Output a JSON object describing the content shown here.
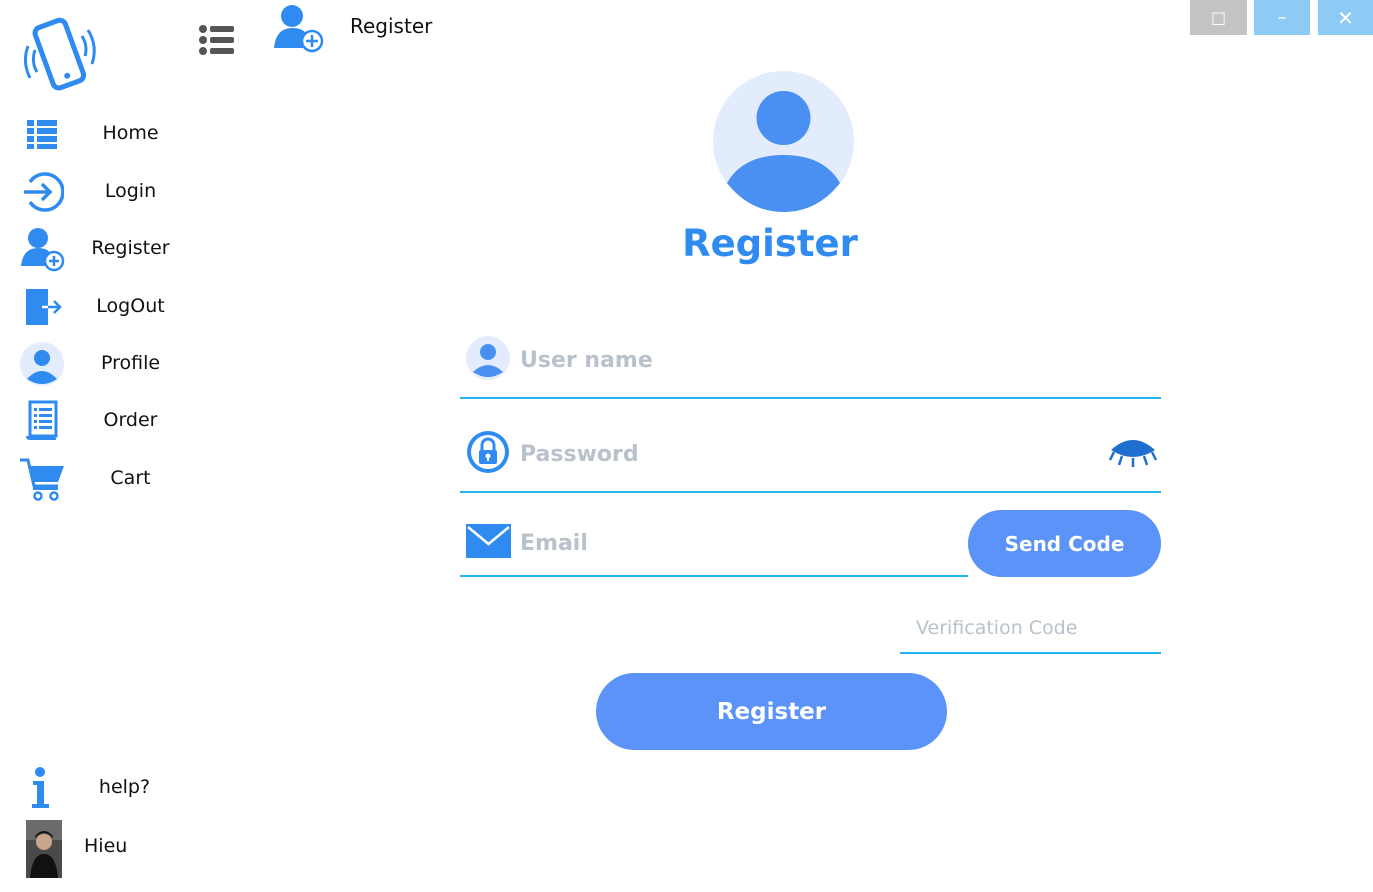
{
  "window": {
    "maximize_glyph": "□",
    "minimize_glyph": "–",
    "close_glyph": "✕"
  },
  "topbar": {
    "title": "Register"
  },
  "sidebar": {
    "items": [
      {
        "label": "Home",
        "icon": "list-icon"
      },
      {
        "label": "Login",
        "icon": "login-arrow-icon"
      },
      {
        "label": "Register",
        "icon": "add-user-icon"
      },
      {
        "label": "LogOut",
        "icon": "logout-icon"
      },
      {
        "label": "Profile",
        "icon": "profile-icon"
      },
      {
        "label": "Order",
        "icon": "order-document-icon"
      },
      {
        "label": "Cart",
        "icon": "cart-icon"
      }
    ],
    "help_label": "help?",
    "user_name": "Hieu"
  },
  "form": {
    "title": "Register",
    "username_placeholder": "User name",
    "password_placeholder": "Password",
    "email_placeholder": "Email",
    "send_code_label": "Send Code",
    "verification_placeholder": "Verification Code",
    "register_label": "Register"
  },
  "colors": {
    "accent": "#2f8bf0",
    "button": "#5b93f8",
    "underline": "#23b5f0",
    "avatar_bg": "#e3ecfd"
  }
}
